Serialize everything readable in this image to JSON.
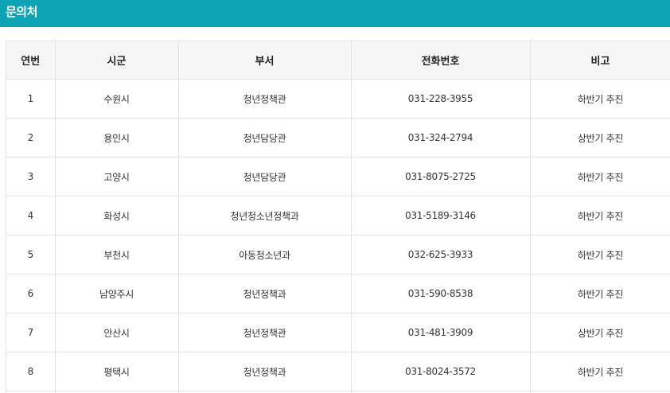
{
  "header": {
    "title": "문의처"
  },
  "table": {
    "columns": [
      "연번",
      "시군",
      "부서",
      "전화번호",
      "비고"
    ],
    "rows": [
      {
        "no": "1",
        "city": "수원시",
        "department": "청년정책관",
        "phone": "031-228-3955",
        "note": "하반기 추진"
      },
      {
        "no": "2",
        "city": "용인시",
        "department": "청년담당관",
        "phone": "031-324-2794",
        "note": "상반기 추진"
      },
      {
        "no": "3",
        "city": "고양시",
        "department": "청년담당관",
        "phone": "031-8075-2725",
        "note": "하반기 추진"
      },
      {
        "no": "4",
        "city": "화성시",
        "department": "청년청소년정책과",
        "phone": "031-5189-3146",
        "note": "하반기 추진"
      },
      {
        "no": "5",
        "city": "부천시",
        "department": "아동청소년과",
        "phone": "032-625-3933",
        "note": "하반기 추진"
      },
      {
        "no": "6",
        "city": "남양주시",
        "department": "청년정책과",
        "phone": "031-590-8538",
        "note": "하반기 추진"
      },
      {
        "no": "7",
        "city": "안산시",
        "department": "청년정책관",
        "phone": "031-481-3909",
        "note": "상반기 추진"
      },
      {
        "no": "8",
        "city": "평택시",
        "department": "청년정책과",
        "phone": "031-8024-3572",
        "note": "하반기 추진"
      }
    ]
  },
  "colors": {
    "header_bar": "#0ea3b5",
    "table_header_bg": "#f6f6f6",
    "border": "#e2e2e2"
  }
}
